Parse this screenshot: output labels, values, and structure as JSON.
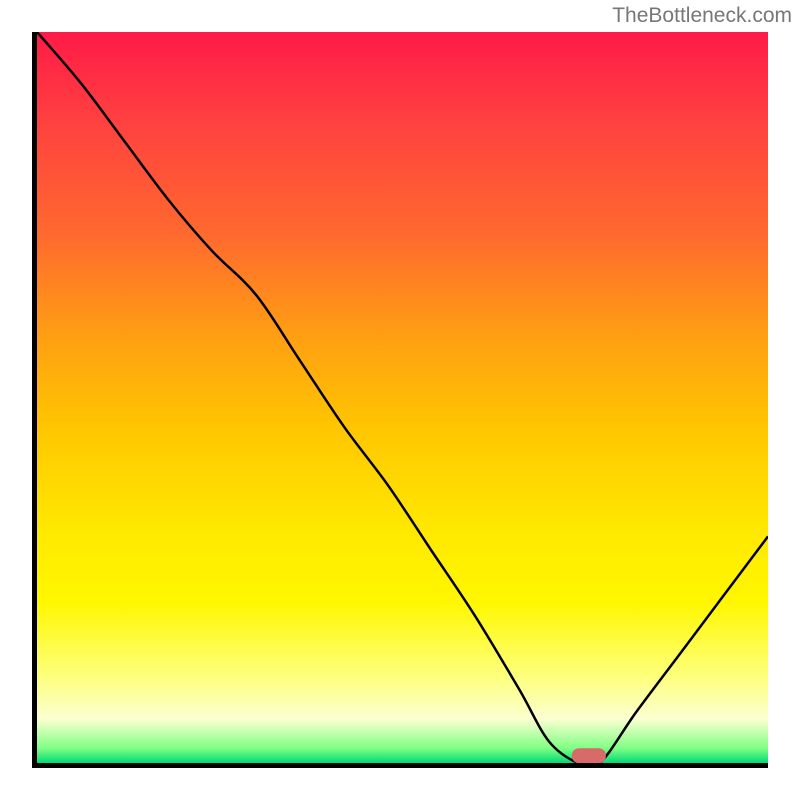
{
  "watermark": "TheBottleneck.com",
  "chart_data": {
    "type": "line",
    "title": "",
    "xlabel": "",
    "ylabel": "",
    "xlim": [
      0,
      1
    ],
    "ylim": [
      0,
      1
    ],
    "axes_visible": {
      "left": true,
      "bottom": true,
      "right": false,
      "top": false
    },
    "background_gradient": {
      "direction": "vertical",
      "stops": [
        {
          "y": 1.0,
          "color": "#ff1a48"
        },
        {
          "y": 0.88,
          "color": "#ff4040"
        },
        {
          "y": 0.72,
          "color": "#ff6a2e"
        },
        {
          "y": 0.58,
          "color": "#ffa012"
        },
        {
          "y": 0.45,
          "color": "#ffc800"
        },
        {
          "y": 0.32,
          "color": "#ffe800"
        },
        {
          "y": 0.22,
          "color": "#fff700"
        },
        {
          "y": 0.12,
          "color": "#fdff7a"
        },
        {
          "y": 0.06,
          "color": "#fbffd0"
        },
        {
          "y": 0.02,
          "color": "#7fff84"
        },
        {
          "y": 0.0,
          "color": "#00d975"
        }
      ]
    },
    "series": [
      {
        "name": "bottleneck-curve",
        "x": [
          0.0,
          0.06,
          0.12,
          0.18,
          0.24,
          0.3,
          0.36,
          0.42,
          0.48,
          0.54,
          0.6,
          0.66,
          0.7,
          0.74,
          0.77,
          0.82,
          0.88,
          0.94,
          1.0
        ],
        "y": [
          1.0,
          0.93,
          0.85,
          0.77,
          0.7,
          0.64,
          0.55,
          0.46,
          0.38,
          0.29,
          0.2,
          0.1,
          0.03,
          0.0,
          0.0,
          0.07,
          0.15,
          0.23,
          0.31
        ]
      }
    ],
    "marker": {
      "x": 0.755,
      "y": 0.01,
      "color": "#d86a6a",
      "shape": "rounded-rect"
    }
  }
}
